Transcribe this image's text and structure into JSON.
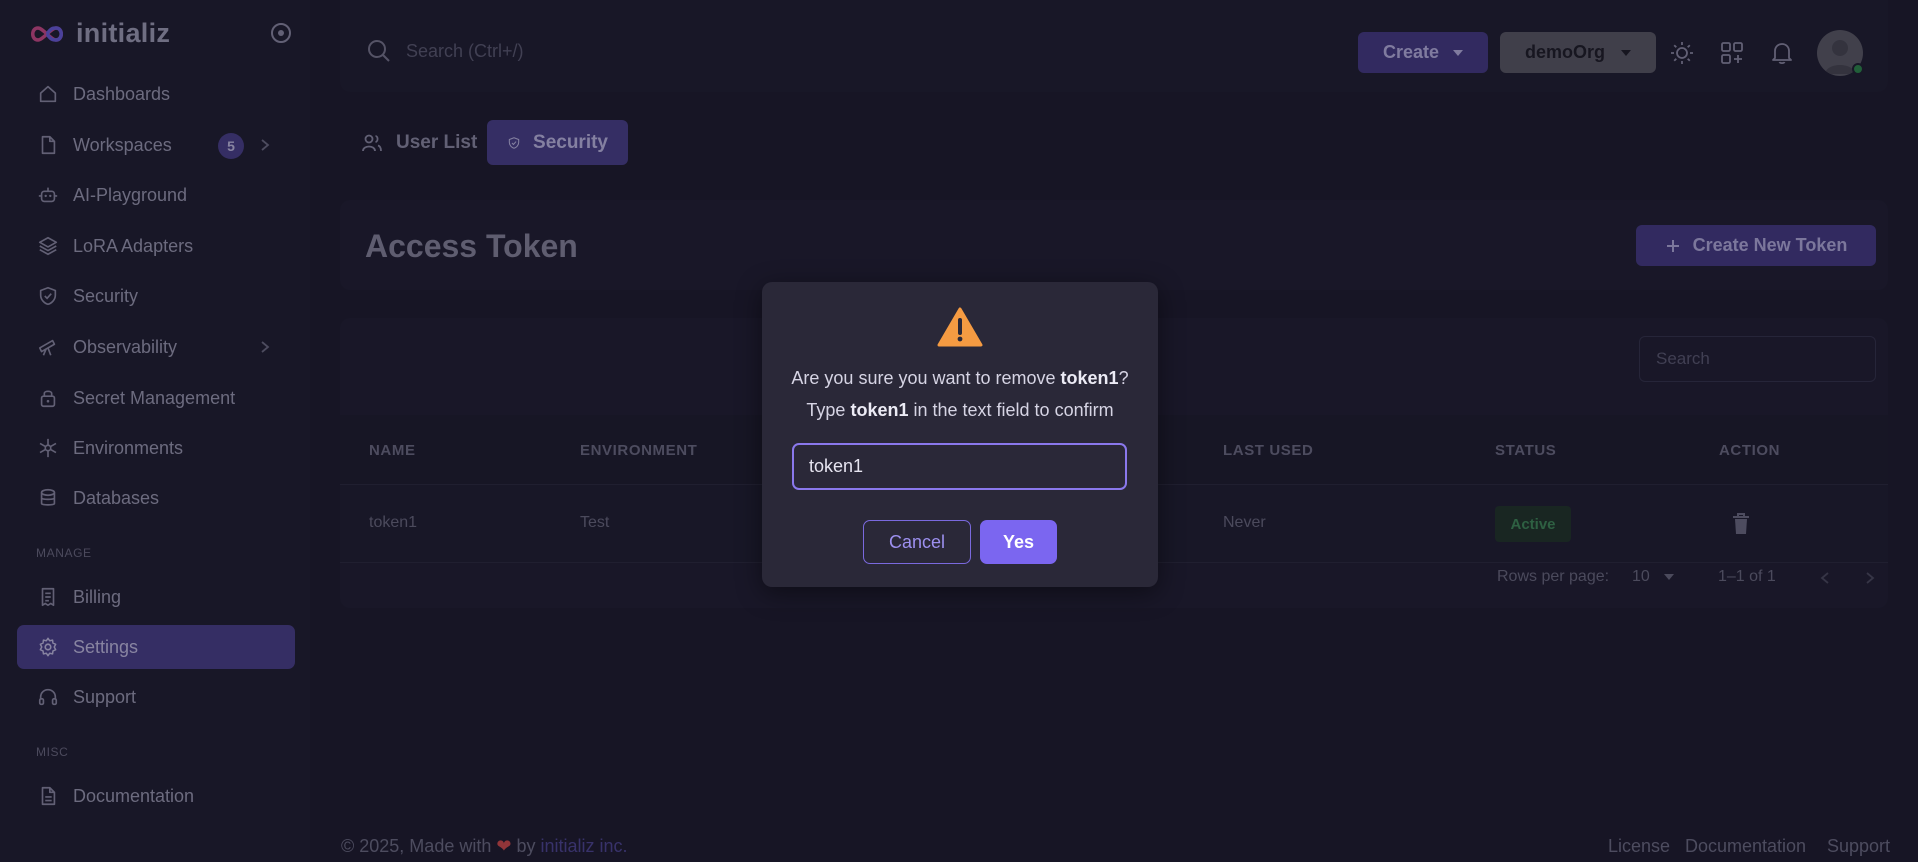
{
  "brand": {
    "name": "initializ"
  },
  "sidebar": {
    "items": [
      {
        "label": "Dashboards"
      },
      {
        "label": "Workspaces",
        "badge": "5"
      },
      {
        "label": "AI-Playground"
      },
      {
        "label": "LoRA Adapters"
      },
      {
        "label": "Security"
      },
      {
        "label": "Observability"
      },
      {
        "label": "Secret Management"
      },
      {
        "label": "Environments"
      },
      {
        "label": "Databases"
      }
    ],
    "manage_label": "MANAGE",
    "manage_items": [
      {
        "label": "Billing"
      },
      {
        "label": "Settings",
        "active": true
      },
      {
        "label": "Support"
      }
    ],
    "misc_label": "MISC",
    "misc_items": [
      {
        "label": "Documentation"
      }
    ]
  },
  "topbar": {
    "search_placeholder": "Search (Ctrl+/)",
    "create_label": "Create",
    "org_label": "demoOrg"
  },
  "tabs": [
    {
      "label": "User List"
    },
    {
      "label": "Security",
      "active": true
    }
  ],
  "page": {
    "title": "Access Token",
    "create_token_label": "Create New Token"
  },
  "table": {
    "search_placeholder": "Search",
    "headers": [
      "NAME",
      "ENVIRONMENT",
      "LAST USED",
      "STATUS",
      "ACTION"
    ],
    "rows": [
      {
        "name": "token1",
        "environment": "Test",
        "last_used": "Never",
        "status": "Active"
      }
    ],
    "rows_per_page_label": "Rows per page:",
    "rows_per_page_value": "10",
    "range": "1–1 of 1"
  },
  "footer": {
    "copyright": "© 2025, Made with",
    "by": "by",
    "company": "initializ inc.",
    "links": [
      "License",
      "Documentation",
      "Support"
    ]
  },
  "dialog": {
    "line1_prefix": "Are you sure you want to remove ",
    "token_name": "token1",
    "line1_suffix": "?",
    "line2_prefix": "Type ",
    "line2_suffix": " in the text field to confirm",
    "input_value": "token1",
    "cancel_label": "Cancel",
    "yes_label": "Yes"
  },
  "colors": {
    "accent": "#7b66f0",
    "warning": "#f59b42",
    "active_status": "#3f8c58",
    "heart": "#d94a4a"
  }
}
